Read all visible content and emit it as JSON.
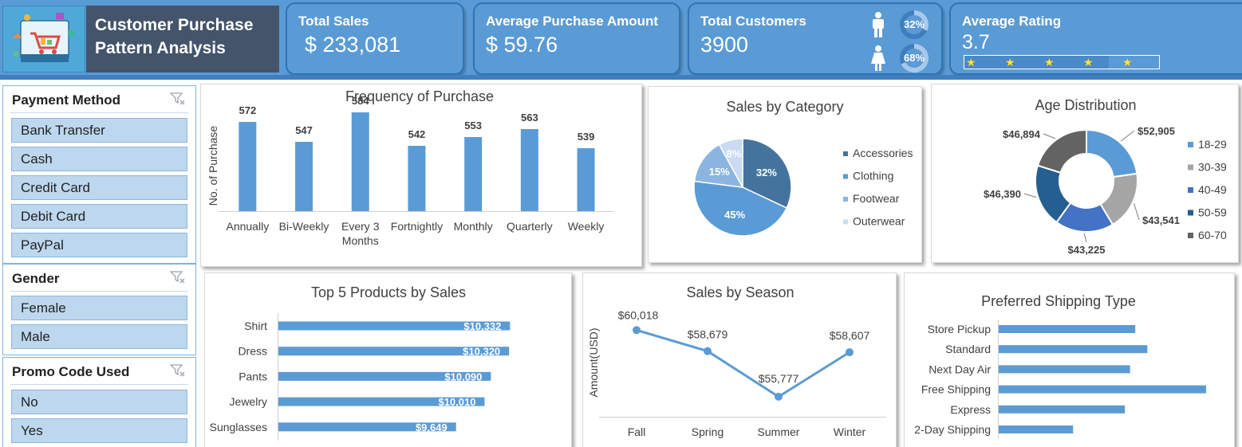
{
  "header": {
    "title_line1": "Customer Purchase",
    "title_line2": "Pattern Analysis"
  },
  "kpis": {
    "total_sales": {
      "label": "Total Sales",
      "value": "$ 233,081"
    },
    "avg_purchase": {
      "label": "Average Purchase Amount",
      "value": "$ 59.76"
    },
    "total_customers": {
      "label": "Total Customers",
      "value": "3900",
      "male_pct": "32%",
      "female_pct": "68%",
      "male_share": 0.32,
      "female_share": 0.68
    },
    "avg_rating": {
      "label": "Average Rating",
      "value": "3.7",
      "rating": 3.7,
      "max": 5
    }
  },
  "slicers": [
    {
      "title": "Payment Method",
      "items": [
        "Bank Transfer",
        "Cash",
        "Credit Card",
        "Debit Card",
        "PayPal"
      ]
    },
    {
      "title": "Gender",
      "items": [
        "Female",
        "Male"
      ]
    },
    {
      "title": "Promo Code Used",
      "items": [
        "No",
        "Yes"
      ]
    }
  ],
  "colors": {
    "accent": "#5b9bd5",
    "title_bg": "#44546a",
    "slicer_item": "#bdd7ee"
  },
  "chart_data": [
    {
      "type": "bar",
      "title": "Frequency of Purchase",
      "ylabel": "No. of Purchase",
      "categories": [
        "Annually",
        "Bi-Weekly",
        "Every 3 Months",
        "Fortnightly",
        "Monthly",
        "Quarterly",
        "Weekly"
      ],
      "values": [
        572,
        547,
        584,
        542,
        553,
        563,
        539
      ],
      "labels": [
        "572",
        "547",
        "584",
        "542",
        "553",
        "563",
        "539"
      ]
    },
    {
      "type": "pie",
      "title": "Sales by Category",
      "categories": [
        "Accessories",
        "Clothing",
        "Footwear",
        "Outerwear"
      ],
      "values": [
        32,
        45,
        15,
        8
      ],
      "labels": [
        "32%",
        "45%",
        "15%",
        "8%"
      ],
      "colors": [
        "#44749d",
        "#5b9bd5",
        "#8cb4e0",
        "#c9dbf0"
      ],
      "legend": "right"
    },
    {
      "type": "pie",
      "title": "Age Distribution",
      "categories": [
        "18-29",
        "30-39",
        "40-49",
        "50-59",
        "60-70"
      ],
      "values": [
        52905,
        43541,
        43225,
        46390,
        46894
      ],
      "labels": [
        "$52,905",
        "$43,541",
        "$43,225",
        "$46,390",
        "$46,894"
      ],
      "colors": [
        "#5b9bd5",
        "#a5a5a5",
        "#4472c4",
        "#255e91",
        "#636363"
      ],
      "legend": "right"
    },
    {
      "type": "bar",
      "title": "Top 5 Products by Sales",
      "orientation": "horizontal",
      "categories": [
        "Shirt",
        "Dress",
        "Pants",
        "Jewelry",
        "Sunglasses"
      ],
      "values": [
        10332,
        10320,
        10090,
        10010,
        9649
      ],
      "labels": [
        "$10,332",
        "$10,320",
        "$10,090",
        "$10,010",
        "$9,649"
      ]
    },
    {
      "type": "line",
      "title": "Sales by Season",
      "ylabel": "Amount(USD)",
      "categories": [
        "Fall",
        "Spring",
        "Summer",
        "Winter"
      ],
      "values": [
        60018,
        58679,
        55777,
        58607
      ],
      "labels": [
        "$60,018",
        "$58,679",
        "$55,777",
        "$58,607"
      ]
    },
    {
      "type": "bar",
      "title": "Preferred Shipping Type",
      "orientation": "horizontal",
      "categories": [
        "Store Pickup",
        "Standard",
        "Next Day Air",
        "Free Shipping",
        "Express",
        "2-Day Shipping"
      ],
      "values": [
        39.5,
        43.0,
        38.0,
        60.0,
        36.5,
        21.5
      ]
    }
  ]
}
